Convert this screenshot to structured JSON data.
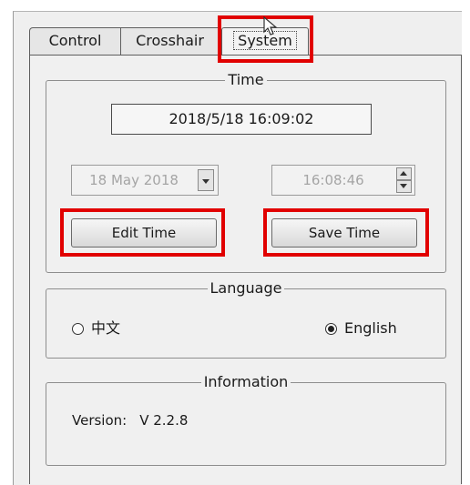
{
  "tabs": [
    {
      "label": "Control"
    },
    {
      "label": "Crosshair"
    },
    {
      "label": "System",
      "active": true
    }
  ],
  "time_group": {
    "title": "Time",
    "current_datetime": "2018/5/18  16:09:02",
    "date_value": "18 May 2018",
    "time_value": "16:08:46",
    "edit_button": "Edit Time",
    "save_button": "Save Time"
  },
  "language_group": {
    "title": "Language",
    "options": [
      {
        "label": "中文",
        "selected": false
      },
      {
        "label": "English",
        "selected": true
      }
    ]
  },
  "information_group": {
    "title": "Information",
    "version_label": "Version:",
    "version_value": "V 2.2.8"
  },
  "colors": {
    "highlight": "#e10000",
    "background": "#f0f0f0"
  }
}
